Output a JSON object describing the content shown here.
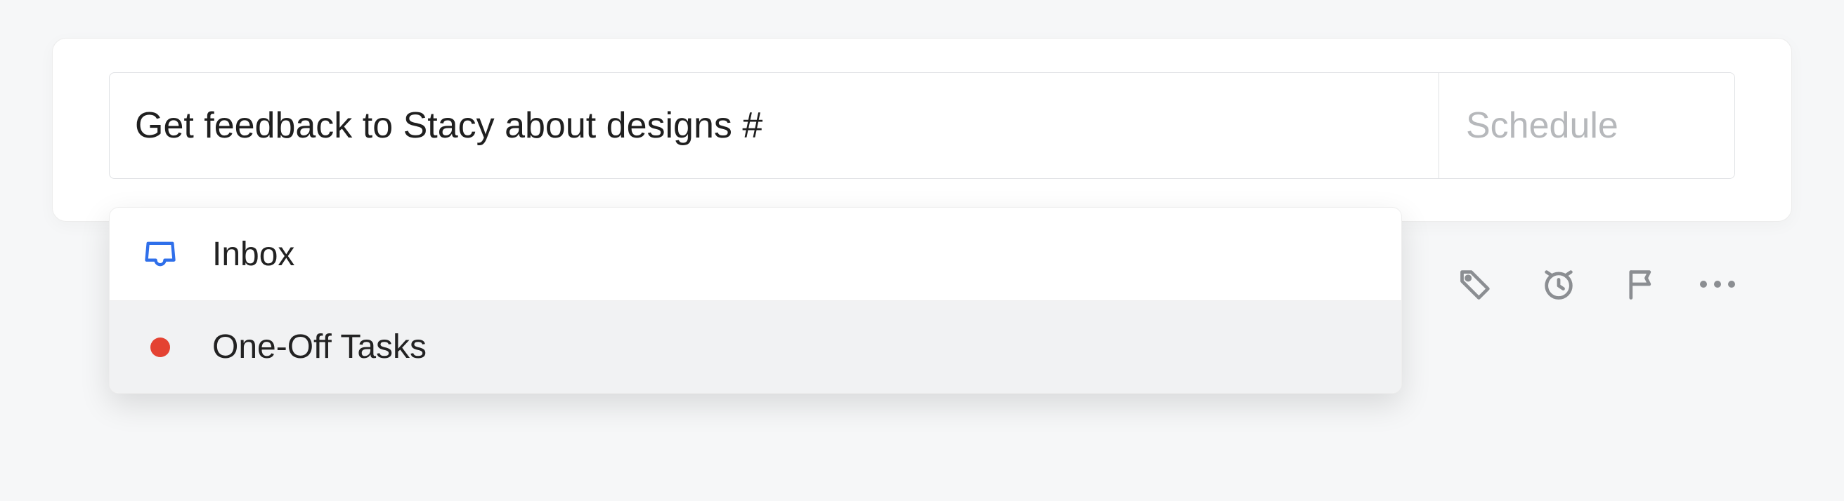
{
  "composer": {
    "input_value": "Get feedback to Stacy about designs #",
    "schedule_label": "Schedule"
  },
  "dropdown": {
    "items": [
      {
        "icon": "inbox",
        "label": "Inbox",
        "hovered": false
      },
      {
        "icon": "project-dot",
        "label": "One-Off Tasks",
        "hovered": true
      }
    ]
  },
  "toolbar": {
    "icons": [
      "tag",
      "alarm",
      "flag",
      "more"
    ]
  }
}
